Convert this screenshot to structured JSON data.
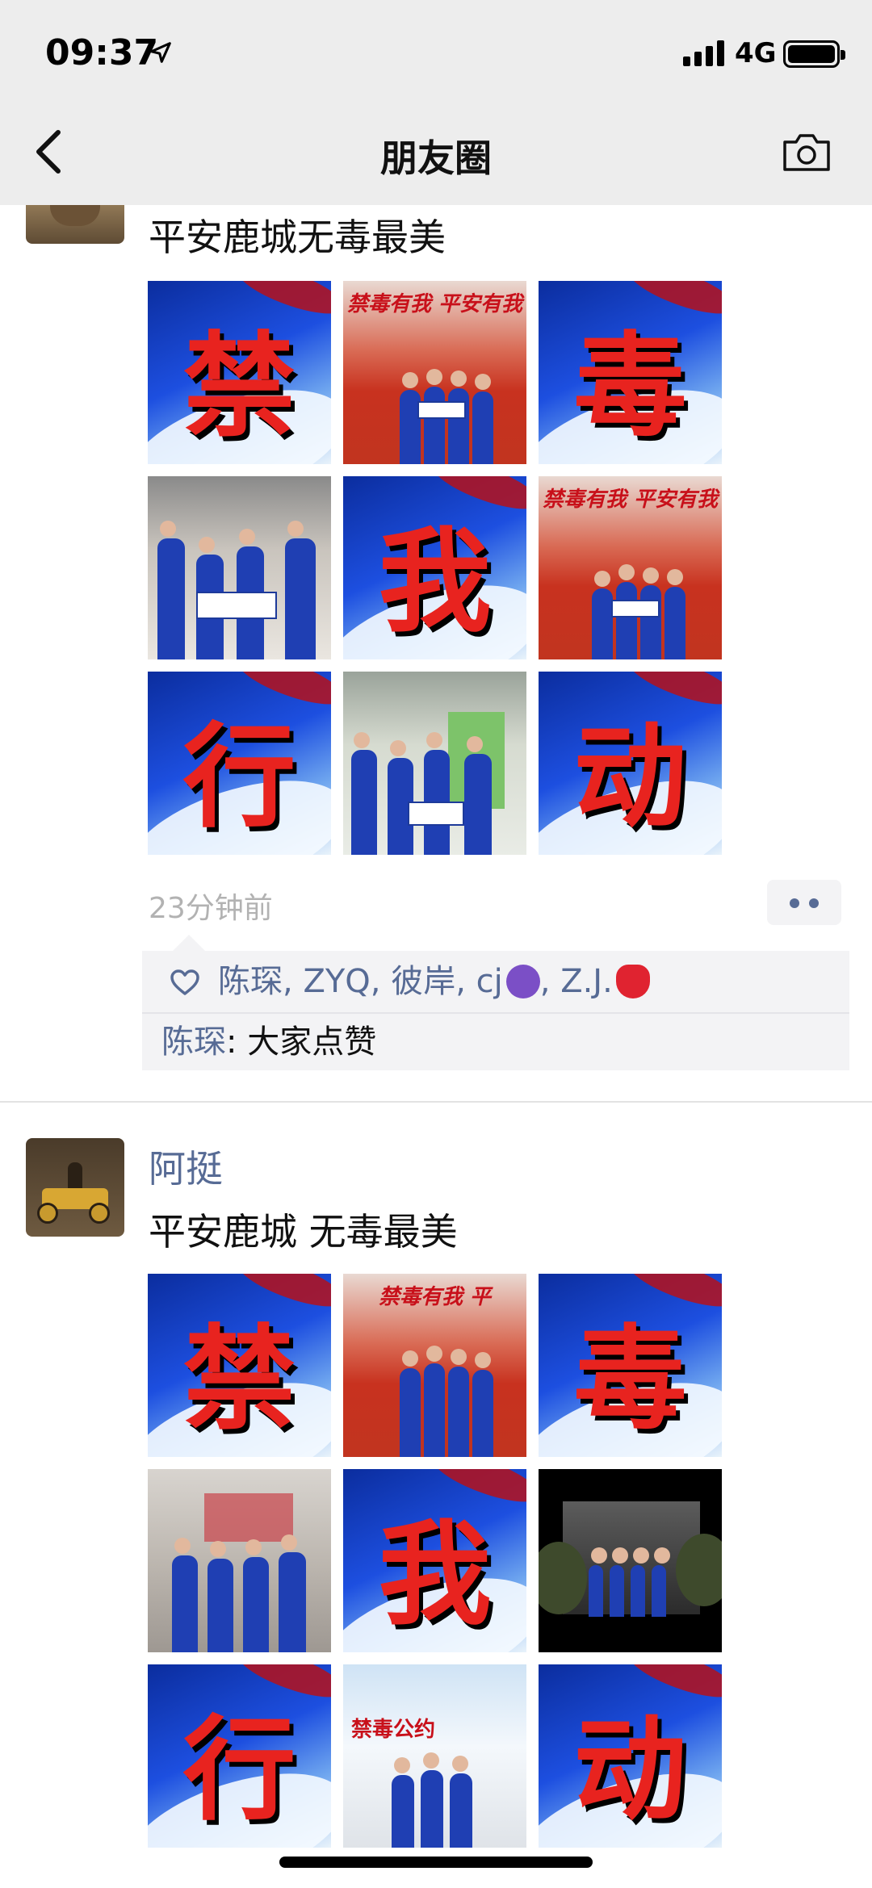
{
  "status_bar": {
    "time": "09:37",
    "network": "4G"
  },
  "nav": {
    "title": "朋友圈"
  },
  "posts": [
    {
      "name": "",
      "text": "平安鹿城无毒最美",
      "images": [
        {
          "kind": "char",
          "char": "禁"
        },
        {
          "kind": "stage",
          "banner": "禁毒有我 平安有我"
        },
        {
          "kind": "char",
          "char": "毒"
        },
        {
          "kind": "street"
        },
        {
          "kind": "char",
          "char": "我"
        },
        {
          "kind": "stage",
          "banner": "禁毒有我 平安有我"
        },
        {
          "kind": "char",
          "char": "行"
        },
        {
          "kind": "street"
        },
        {
          "kind": "char",
          "char": "动"
        }
      ],
      "time": "23分钟前",
      "likes": [
        "陈琛",
        "ZYQ",
        "彼岸",
        "cj",
        "Z.J."
      ],
      "likes_separator": ", ",
      "likes_emoji": {
        "cj": "devil-emoji",
        "Z.J.": "strawberry-emoji"
      },
      "comments": [
        {
          "name": "陈琛",
          "text": "大家点赞"
        }
      ]
    },
    {
      "name": "阿挺",
      "text": "平安鹿城 无毒最美",
      "images": [
        {
          "kind": "char",
          "char": "禁"
        },
        {
          "kind": "stage",
          "banner": "禁毒有我 平"
        },
        {
          "kind": "char",
          "char": "毒"
        },
        {
          "kind": "street"
        },
        {
          "kind": "char",
          "char": "我"
        },
        {
          "kind": "dark"
        },
        {
          "kind": "char",
          "char": "行"
        },
        {
          "kind": "sign",
          "banner": "禁毒公约"
        },
        {
          "kind": "char",
          "char": "动"
        }
      ]
    }
  ],
  "icons": {
    "back": "chevron-left-icon",
    "camera": "camera-icon",
    "like": "heart-icon",
    "more": "more-dots-icon"
  },
  "colors": {
    "link": "#576b95",
    "nav_bg": "#ededed",
    "likes_bg": "#f3f3f5",
    "time": "#b2b2b2"
  }
}
